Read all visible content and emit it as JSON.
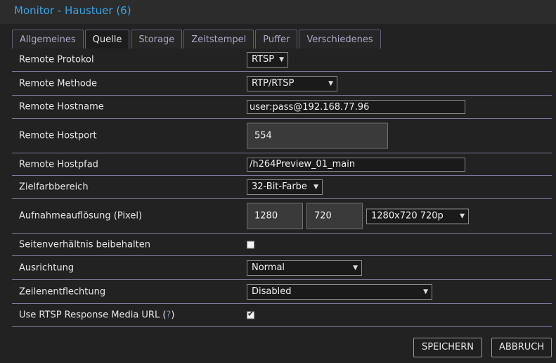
{
  "window": {
    "title": "Monitor - Haustuer (6)"
  },
  "tabs": [
    {
      "label": "Allgemeines",
      "active": false
    },
    {
      "label": "Quelle",
      "active": true
    },
    {
      "label": "Storage",
      "active": false
    },
    {
      "label": "Zeitstempel",
      "active": false
    },
    {
      "label": "Puffer",
      "active": false
    },
    {
      "label": "Verschiedenes",
      "active": false
    }
  ],
  "form": {
    "remote_protocol": {
      "label": "Remote Protokol",
      "value": "RTSP"
    },
    "remote_method": {
      "label": "Remote Methode",
      "value": "RTP/RTSP"
    },
    "remote_hostname": {
      "label": "Remote Hostname",
      "value": "user:pass@192.168.77.96"
    },
    "remote_hostport": {
      "label": "Remote Hostport",
      "value": "554"
    },
    "remote_hostpath": {
      "label": "Remote Hostpfad",
      "value": "/h264Preview_01_main"
    },
    "target_color": {
      "label": "Zielfarbbereich",
      "value": "32-Bit-Farbe"
    },
    "resolution": {
      "label": "Aufnahmeauflösung (Pixel)",
      "width": "1280",
      "height": "720",
      "preset": "1280x720 720p"
    },
    "keep_aspect": {
      "label": "Seitenverhältnis beibehalten",
      "checked": false
    },
    "orientation": {
      "label": "Ausrichtung",
      "value": "Normal"
    },
    "deinterlacing": {
      "label": "Zeilenentflechtung",
      "value": "Disabled"
    },
    "rtsp_media_url": {
      "label_prefix": "Use RTSP Response Media URL (",
      "help": "?",
      "label_suffix": ")",
      "checked": true
    }
  },
  "footer": {
    "save_label": "SPEICHERN",
    "cancel_label": "ABBRUCH"
  },
  "icons": {
    "dropdown": "chevron-down-icon",
    "checkmark": "check-icon"
  },
  "colors": {
    "title": "#3aa3e3",
    "tab_text": "#a9a9c9",
    "row_divider": "#7a7a9c",
    "background": "#222222"
  }
}
